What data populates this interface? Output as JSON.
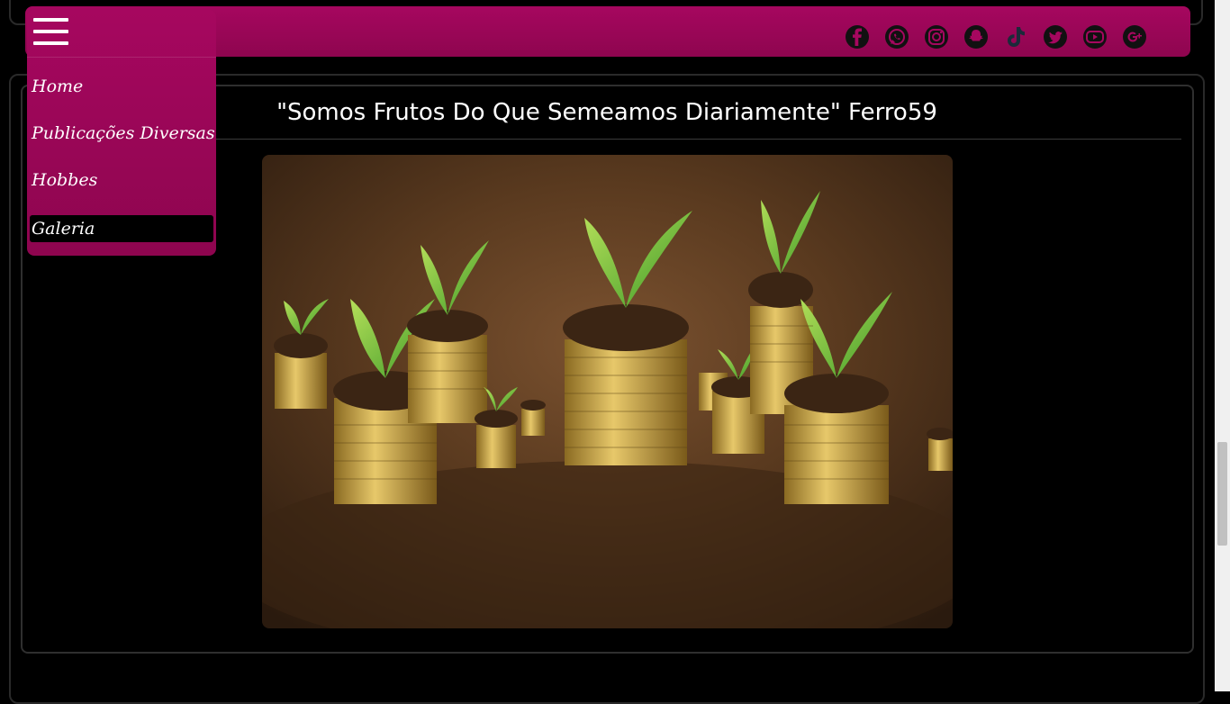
{
  "header": {
    "social_icons": [
      "facebook-icon",
      "whatsapp-icon",
      "instagram-icon",
      "snapchat-icon",
      "tiktok-icon",
      "twitter-icon",
      "youtube-icon",
      "google-plus-icon"
    ]
  },
  "menu": {
    "items": [
      {
        "label": "Home"
      },
      {
        "label": "Publicações Diversas"
      },
      {
        "label": "Hobbes"
      },
      {
        "label": "Galeria",
        "active": true
      }
    ]
  },
  "main": {
    "title": "\"Somos Frutos Do Que Semeamos Diariamente\" Ferro59",
    "image_icon": "coins-with-sprouts-photo"
  },
  "colors": {
    "header_bg": "#a6075f",
    "page_bg": "#000000",
    "active_menu_bg": "#000000",
    "text": "#ffffff"
  }
}
